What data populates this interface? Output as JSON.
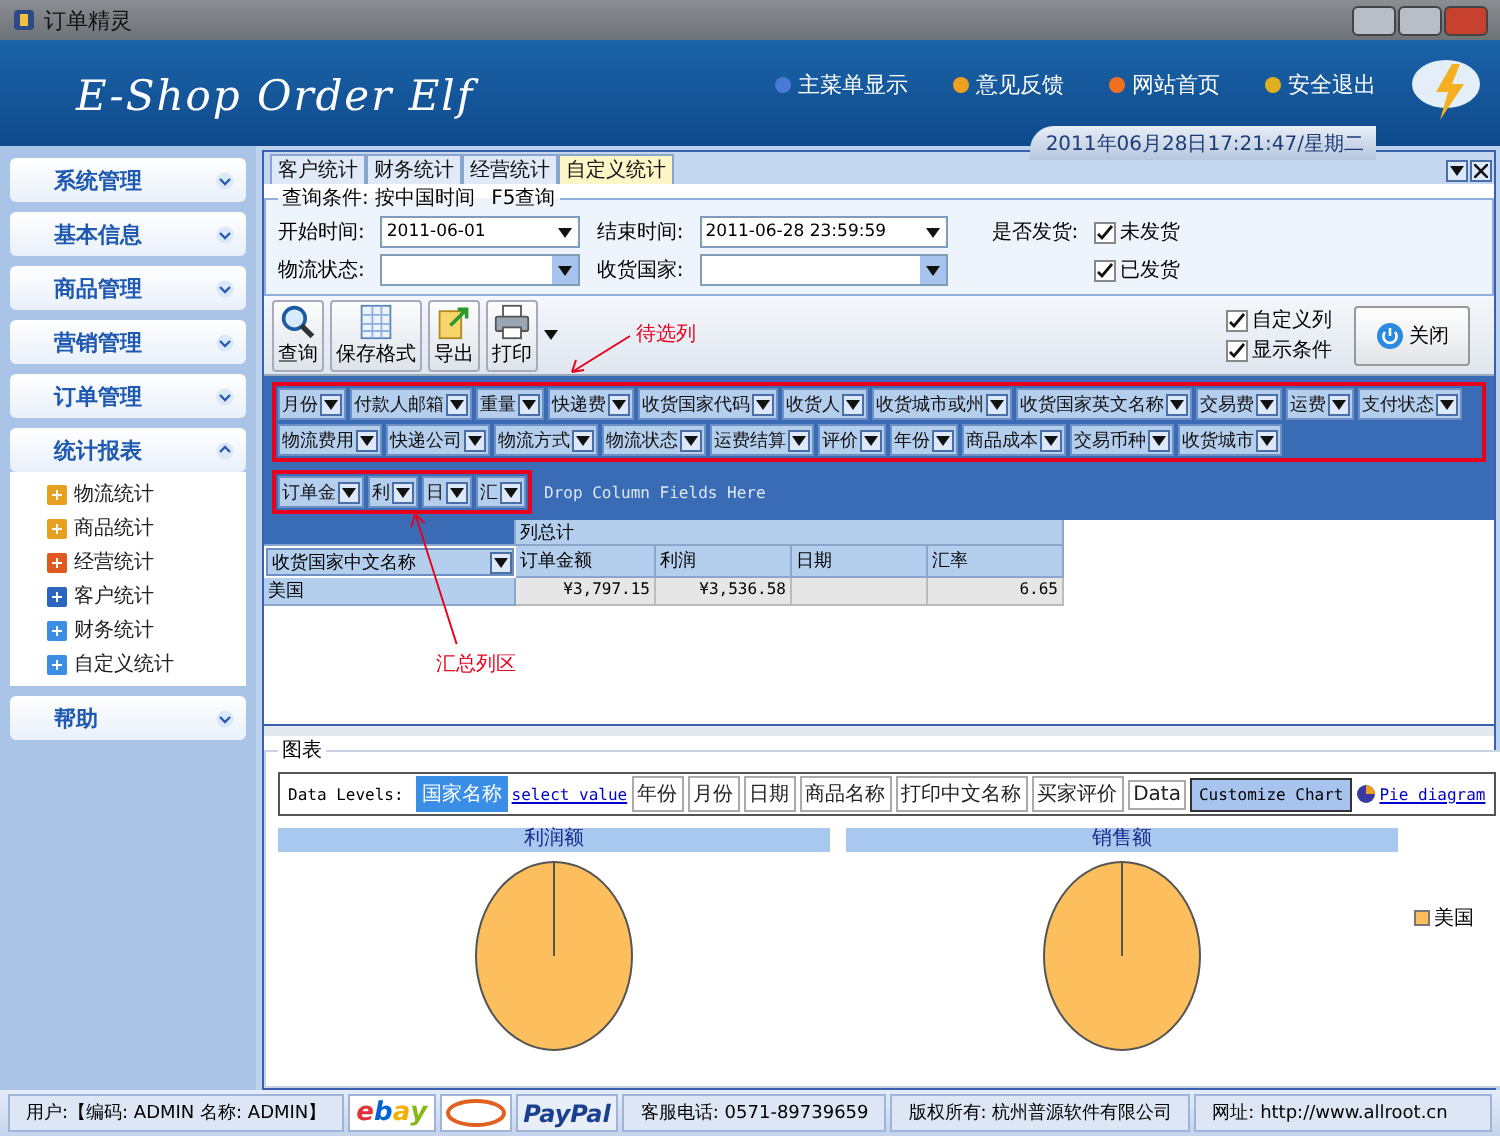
{
  "window": {
    "title": "订单精灵"
  },
  "header": {
    "logo": "E-Shop Order Elf",
    "links": [
      {
        "label": "主菜单显示"
      },
      {
        "label": "意见反馈"
      },
      {
        "label": "网站首页"
      },
      {
        "label": "安全退出"
      }
    ],
    "datetime": "2011年06月28日17:21:47/星期二"
  },
  "sidebar": {
    "groups": [
      {
        "label": "系统管理",
        "expanded": false
      },
      {
        "label": "基本信息",
        "expanded": false
      },
      {
        "label": "商品管理",
        "expanded": false
      },
      {
        "label": "营销管理",
        "expanded": false
      },
      {
        "label": "订单管理",
        "expanded": false
      },
      {
        "label": "统计报表",
        "expanded": true,
        "items": [
          "物流统计",
          "商品统计",
          "经营统计",
          "客户统计",
          "财务统计",
          "自定义统计"
        ]
      },
      {
        "label": "帮助",
        "expanded": false
      }
    ]
  },
  "tabs": [
    {
      "label": "客户统计",
      "selected": false
    },
    {
      "label": "财务统计",
      "selected": false
    },
    {
      "label": "经营统计",
      "selected": false
    },
    {
      "label": "自定义统计",
      "selected": true
    }
  ],
  "query": {
    "legend": "查询条件: 按中国时间",
    "hint": "F5查询",
    "start_time": {
      "label": "开始时间:",
      "value": "2011-06-01"
    },
    "end_time": {
      "label": "结束时间:",
      "value": "2011-06-28 23:59:59"
    },
    "logistics_status": {
      "label": "物流状态:"
    },
    "country": {
      "label": "收货国家:"
    },
    "shipped": {
      "label": "是否发货:",
      "options": [
        {
          "label": "未发货",
          "checked": true
        },
        {
          "label": "已发货",
          "checked": true
        }
      ]
    }
  },
  "toolbar": {
    "buttons": [
      {
        "label": "查询",
        "kind": "search"
      },
      {
        "label": "保存格式",
        "kind": "save"
      },
      {
        "label": "导出",
        "kind": "export"
      },
      {
        "label": "打印",
        "kind": "print"
      }
    ],
    "options": [
      {
        "label": "自定义列",
        "checked": true
      },
      {
        "label": "显示条件",
        "checked": true
      }
    ],
    "close": "关闭"
  },
  "pivot": {
    "filter_fields": [
      "月份",
      "付款人邮箱",
      "重量",
      "快递费",
      "收货国家代码",
      "收货人",
      "收货城市或州",
      "收货国家英文名称",
      "交易费",
      "运费",
      "支付状态",
      "物流费用",
      "快递公司",
      "物流方式",
      "物流状态",
      "运费结算",
      "评价",
      "年份",
      "商品成本",
      "交易币种",
      "收货城市"
    ],
    "filter_note": "待选列",
    "data_fields": [
      "订单金",
      "利",
      "日",
      "汇"
    ],
    "data_note": "汇总列区",
    "drop_hint": "Drop Column Fields Here",
    "row_field": "收货国家中文名称",
    "total_header": "列总计",
    "columns": [
      "订单金额",
      "利润",
      "日期",
      "汇率"
    ],
    "rows": [
      {
        "label": "美国",
        "cells": [
          "¥3,797.15",
          "¥3,536.58",
          null,
          "6.65"
        ]
      }
    ]
  },
  "chart_section": {
    "title": "图表",
    "levels_label": "Data Levels:",
    "levels": [
      {
        "label": "国家名称",
        "kind": "level",
        "selected": true
      },
      {
        "label": "select value",
        "kind": "link",
        "selected": false
      },
      {
        "label": "年份",
        "kind": "level",
        "selected": false
      },
      {
        "label": "月份",
        "kind": "level",
        "selected": false
      },
      {
        "label": "日期",
        "kind": "level",
        "selected": false
      },
      {
        "label": "商品名称",
        "kind": "level",
        "selected": false
      },
      {
        "label": "打印中文名称",
        "kind": "level",
        "selected": false
      },
      {
        "label": "买家评价",
        "kind": "level",
        "selected": false
      },
      {
        "label": "Data",
        "kind": "level",
        "selected": false
      }
    ],
    "customize": "Customize Chart",
    "pie_link": "Pie diagram",
    "charts": [
      {
        "title": "利润额"
      },
      {
        "title": "销售额"
      }
    ],
    "legend": [
      {
        "label": "美国",
        "color": "#fdbf5e"
      }
    ]
  },
  "status_bar": {
    "user": "用户:【编码: ADMIN  名称: ADMIN】",
    "ebay": "ebay",
    "paypal": "PayPal",
    "phone": "客服电话: 0571-89739659",
    "copyright": "版权所有: 杭州普源软件有限公司",
    "website": "网址: http://www.allroot.cn"
  }
}
